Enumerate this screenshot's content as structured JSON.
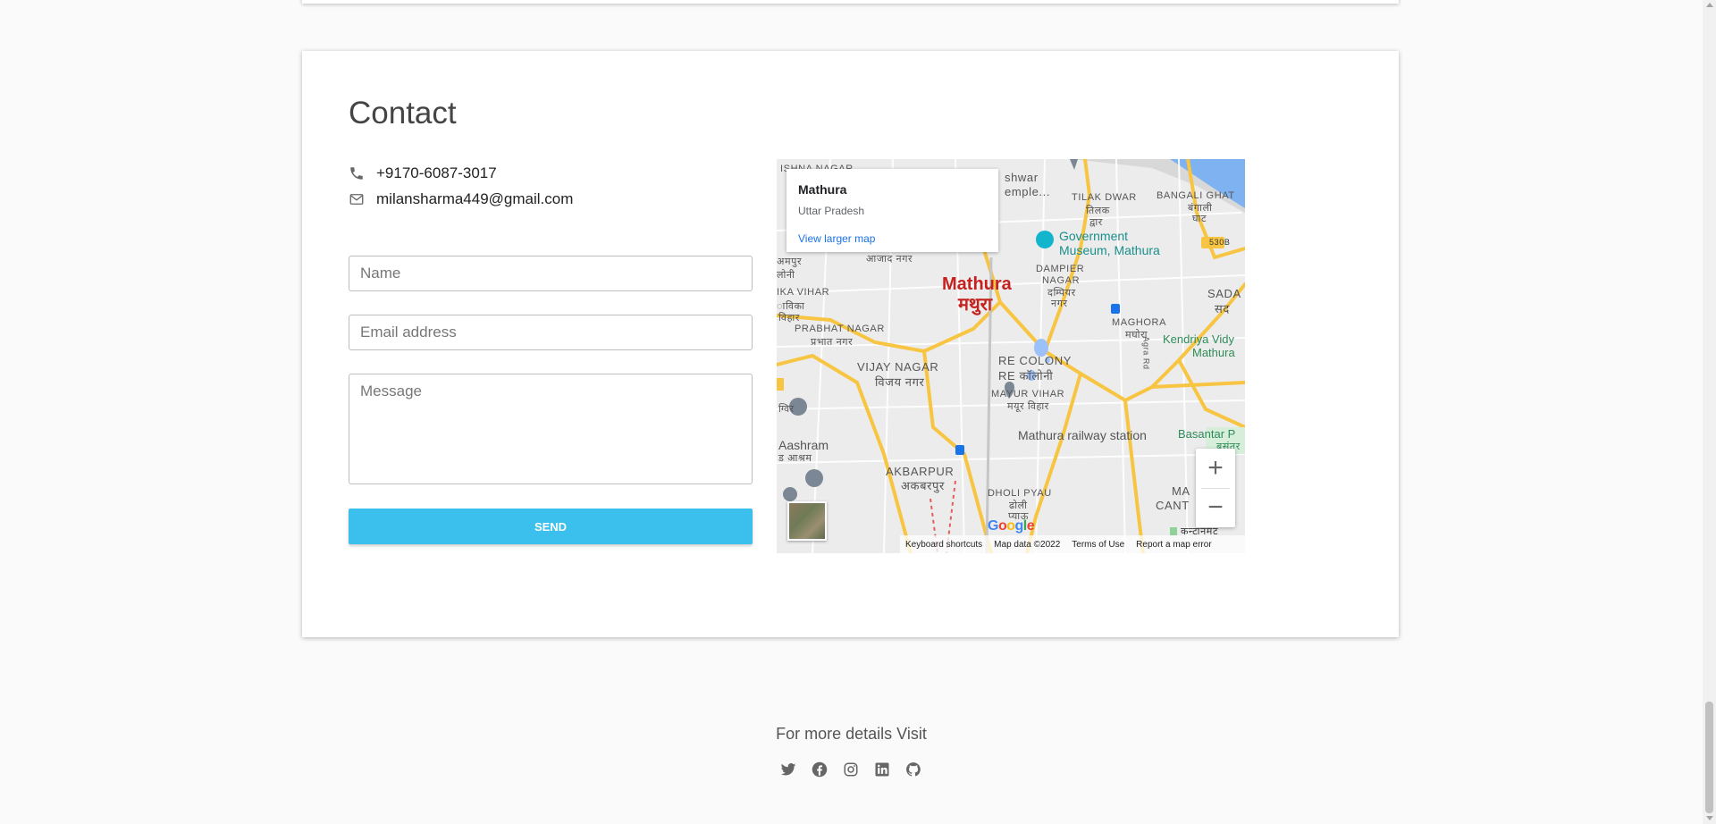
{
  "contact": {
    "title": "Contact",
    "phone": "+9170-6087-3017",
    "email": "milansharma449@gmail.com",
    "form": {
      "name_placeholder": "Name",
      "email_placeholder": "Email address",
      "message_placeholder": "Message",
      "send_label": "SEND"
    }
  },
  "map": {
    "infocard": {
      "place": "Mathura",
      "region": "Uttar Pradesh",
      "link": "View larger map"
    },
    "labels": {
      "city_en": "Mathura",
      "city_hi": "मथुरा",
      "tilak_dwar": "TILAK DWAR",
      "tilak_dwar_hi": "तिलक",
      "tilak_dwar_hi2": "द्वार",
      "bangali_ghat": "BANGALI GHAT",
      "bangali_ghat_hi": "बंगाली",
      "bangali_ghat_hi2": "घाट",
      "museum_1": "Government",
      "museum_2": "Museum, Mathura",
      "dampier_1": "DAMPIER",
      "dampier_2": "NAGAR",
      "dampier_hi": "दम्पियर",
      "dampier_hi2": "नगर",
      "maghora": "MAGHORA",
      "maghora_hi": "मघोरा",
      "azad_nagar": "आजाद नगर",
      "ishna": "ISHNA NAGAR",
      "shwar": "shwar",
      "temple": "emple...",
      "prabhat": "PRABHAT NAGAR",
      "prabhat_hi": "प्रभात नगर",
      "vijay": "VIJAY NAGAR",
      "vijay_hi": "विजय नगर",
      "re_colony": "RE COLONY",
      "re_colony_hi": "RE कॉलोनी",
      "mayur": "MAYUR VIHAR",
      "mayur_hi": "मयूर विहार",
      "station": "Mathura railway station",
      "aashram": "Aashram",
      "aashram_hi": "ड आश्रम",
      "akbarpur": "AKBARPUR",
      "akbarpur_hi": "अकबरपुर",
      "dholi": "DHOLI PYAU",
      "dholi_hi": "ढोली",
      "dholi_hi2": "प्याऊ",
      "sada": "SADA",
      "sada_hi": "सद",
      "kendriya": "Kendriya Vidy",
      "kendriya2": "Mathura",
      "basantar": "Basantar P",
      "basantar_hi": "बसंतर",
      "cant": "MA",
      "cant2": "CANT",
      "cant_hi": "कन्टानमट",
      "agra_rd": "Agra Rd",
      "road_530b": "530B",
      "left_1": "अमपुर",
      "left_2": "लोनी",
      "left_3": "IKA VIHAR",
      "left_4": "ाविका",
      "left_5": "विहार",
      "left_6": "ग्विर"
    },
    "zoom_in": "+",
    "zoom_out": "−",
    "google": "Google",
    "attribution": {
      "shortcuts": "Keyboard shortcuts",
      "data": "Map data ©2022",
      "terms": "Terms of Use",
      "report": "Report a map error"
    }
  },
  "footer": {
    "text": "For more details Visit",
    "socials": [
      "twitter-icon",
      "facebook-icon",
      "instagram-icon",
      "linkedin-icon",
      "github-icon"
    ]
  },
  "colors": {
    "accent": "#3bbfec",
    "background": "#fafafa",
    "city_label": "#c5221f",
    "link": "#1a73e8"
  }
}
